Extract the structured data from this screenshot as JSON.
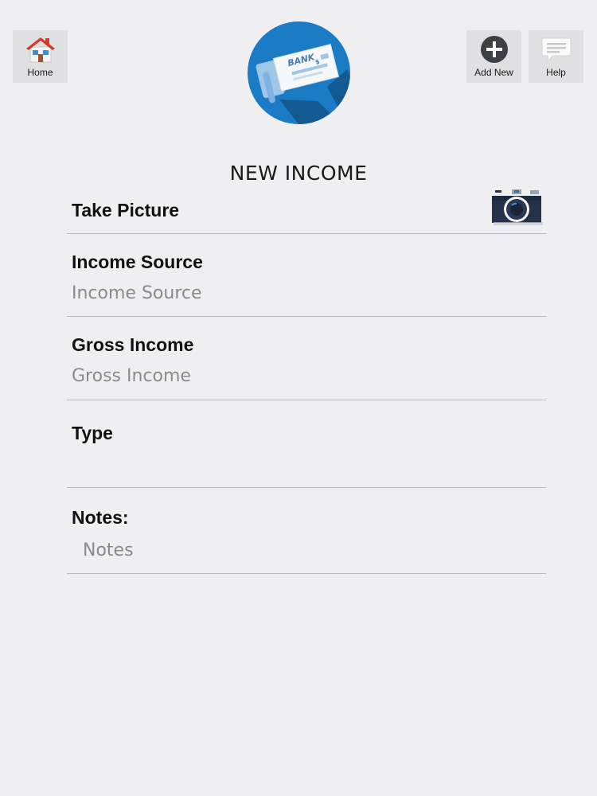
{
  "toolbar": {
    "home_label": "Home",
    "add_new_label": "Add New",
    "help_label": "Help"
  },
  "hero": {
    "icon": "bank-check-icon",
    "check_text": "BANK",
    "dollar_sign": "$"
  },
  "page_title": "NEW INCOME",
  "form": {
    "take_picture_label": "Take Picture",
    "camera_icon": "camera-icon",
    "income_source_label": "Income Source",
    "income_source_value": "",
    "income_source_placeholder": "Income Source",
    "gross_income_label": "Gross Income",
    "gross_income_value": "",
    "gross_income_placeholder": "Gross Income",
    "type_label": "Type",
    "type_value": "",
    "notes_label": "Notes:",
    "notes_value": "",
    "notes_placeholder": "Notes"
  },
  "colors": {
    "background": "#efeff1",
    "toolbar_button": "#e0e0e2",
    "hero_circle": "#1b7bc4",
    "divider": "#b9b9bb",
    "placeholder": "#8a8a8e"
  }
}
